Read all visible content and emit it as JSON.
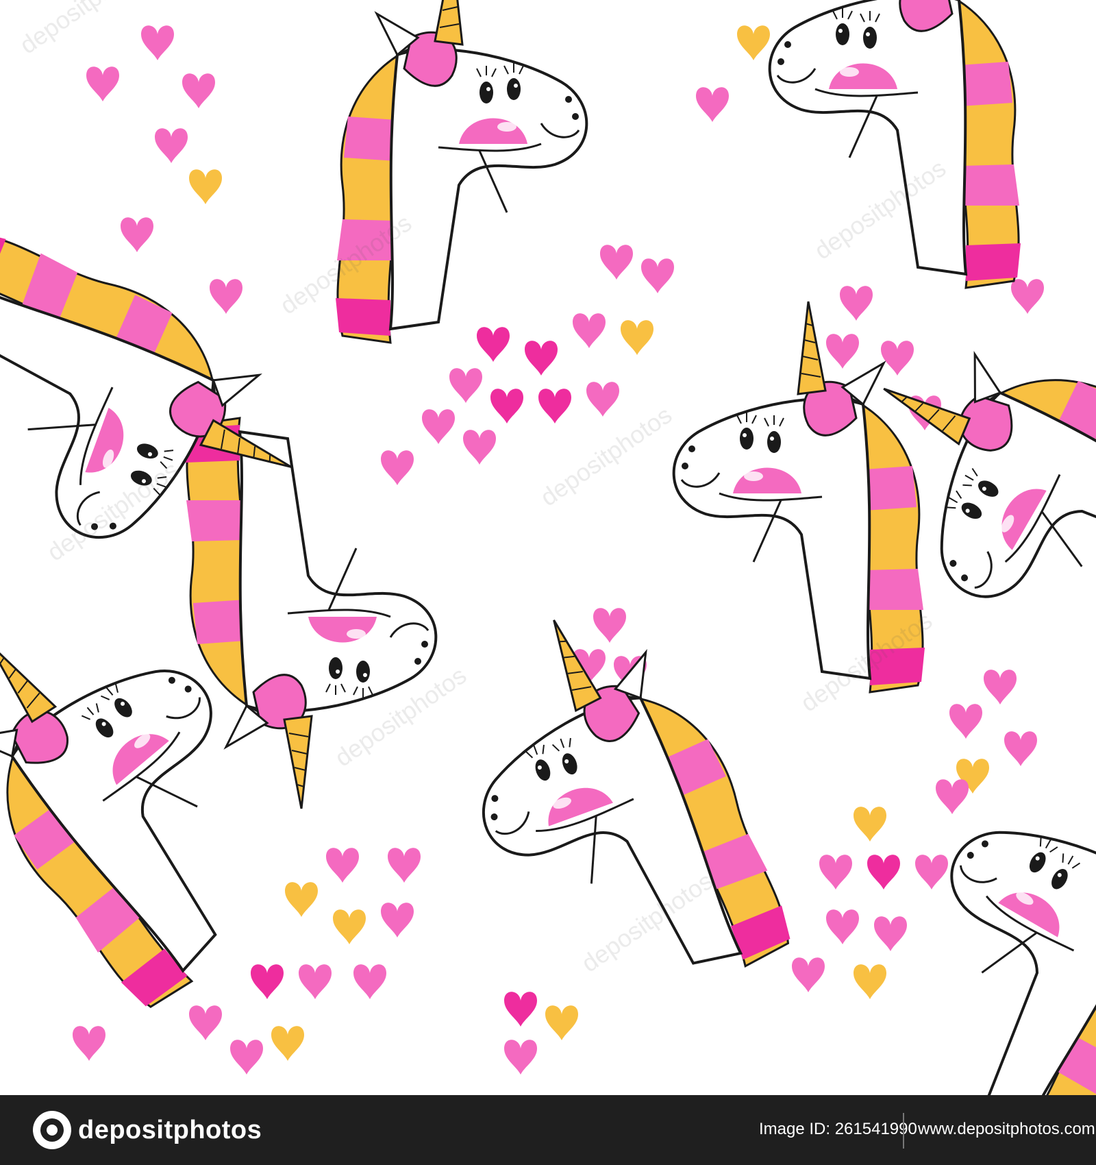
{
  "image": {
    "description_colors": {
      "pink": "#f46ac0",
      "hot_pink": "#ee2d9e",
      "yellow": "#f8c042",
      "outline": "#1a1a1a",
      "background": "#ffffff"
    },
    "watermark_text": "depositphotos"
  },
  "footer": {
    "brand": "depositphotos",
    "image_id_label": "Image ID: 261541990",
    "url": "www.depositphotos.com",
    "colors": {
      "bar": "#1f1f1f",
      "text": "#ffffff"
    }
  }
}
